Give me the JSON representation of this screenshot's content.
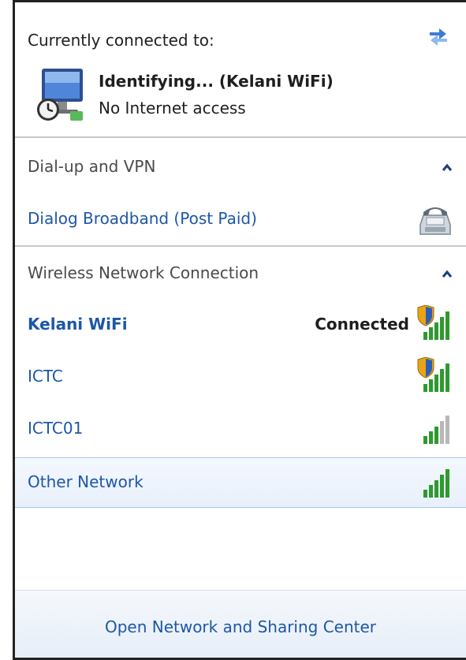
{
  "header": {
    "currently_connected_label": "Currently connected to:",
    "network_name": "Identifying... (Kelani WiFi)",
    "network_status": "No Internet access"
  },
  "dialup": {
    "section_title": "Dial-up and VPN",
    "items": [
      {
        "label": "Dialog Broadband (Post Paid)",
        "icon": "phone-modem-icon"
      }
    ]
  },
  "wireless": {
    "section_title": "Wireless Network Connection",
    "networks": [
      {
        "name": "Kelani WiFi",
        "status": "Connected",
        "secured": true,
        "signal_bars": 5,
        "connected": true
      },
      {
        "name": "ICTC",
        "status": "",
        "secured": true,
        "signal_bars": 5,
        "connected": false
      },
      {
        "name": "ICTC01",
        "status": "",
        "secured": false,
        "signal_bars": 3,
        "connected": false
      },
      {
        "name": "Other Network",
        "status": "",
        "secured": false,
        "signal_bars": 5,
        "connected": false
      }
    ]
  },
  "footer": {
    "link_label": "Open Network and Sharing Center"
  },
  "colors": {
    "link": "#1d57a6",
    "signal_green": "#2e9a2e",
    "signal_grey": "#b8b8b8",
    "shield_gold": "#e8a415"
  }
}
